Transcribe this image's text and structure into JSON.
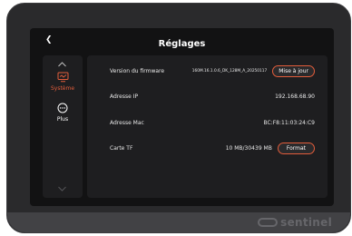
{
  "header": {
    "title": "Réglages"
  },
  "sidebar": {
    "items": [
      {
        "label": "Système",
        "icon": "monitor-icon",
        "active": true
      },
      {
        "label": "Plus",
        "icon": "more-icon",
        "active": false
      }
    ]
  },
  "settings": {
    "firmware": {
      "label": "Version du firmware",
      "value": "160M.16.1.0.6_DK_128M_A_20250117",
      "button": "Mise à jour"
    },
    "ip": {
      "label": "Adresse IP",
      "value": "192.168.68.90"
    },
    "mac": {
      "label": "Adresse Mac",
      "value": "BC:F8:11:03:24:C9"
    },
    "tf": {
      "label": "Carte TF",
      "value": "10 MB/30439 MB",
      "button": "Format"
    }
  },
  "device": {
    "brand": "sentinel"
  },
  "colors": {
    "accent": "#e35d3b",
    "panel": "#1e1e20",
    "screen": "#121213"
  }
}
